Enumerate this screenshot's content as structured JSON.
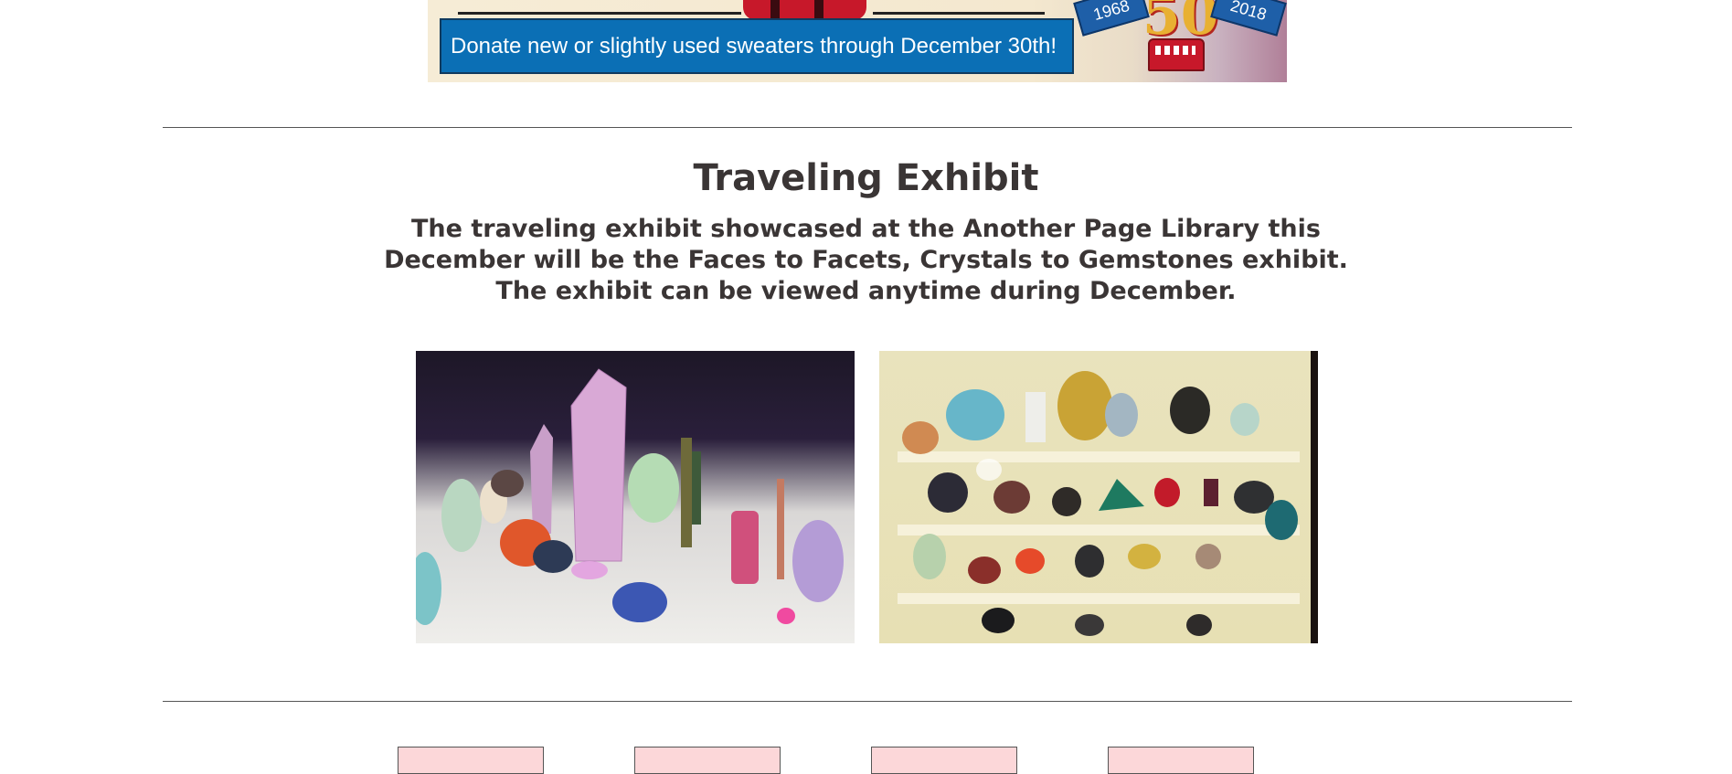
{
  "banner": {
    "donate_text": "Donate new or slightly used sweaters through December 30th!",
    "anniversary_start": "1968",
    "anniversary_end": "2018",
    "anniversary_number": "50"
  },
  "exhibit": {
    "heading": "Traveling Exhibit",
    "description": "The traveling exhibit showcased at the Another Page Library this December will be the Faces to Facets, Crystals to Gemstones exhibit. The exhibit can be viewed anytime during December."
  },
  "photos": [
    {
      "name": "crystal-display-photo",
      "description_icon": "crystals-image"
    },
    {
      "name": "mineral-shelves-photo",
      "description_icon": "minerals-image"
    }
  ],
  "nav": [
    {
      "label": ""
    },
    {
      "label": ""
    },
    {
      "label": ""
    },
    {
      "label": ""
    }
  ],
  "colors": {
    "text": "#3a3535",
    "donate_bg": "#0b6fb5",
    "nav_bg": "#fcd7d9",
    "divider": "#555555"
  }
}
